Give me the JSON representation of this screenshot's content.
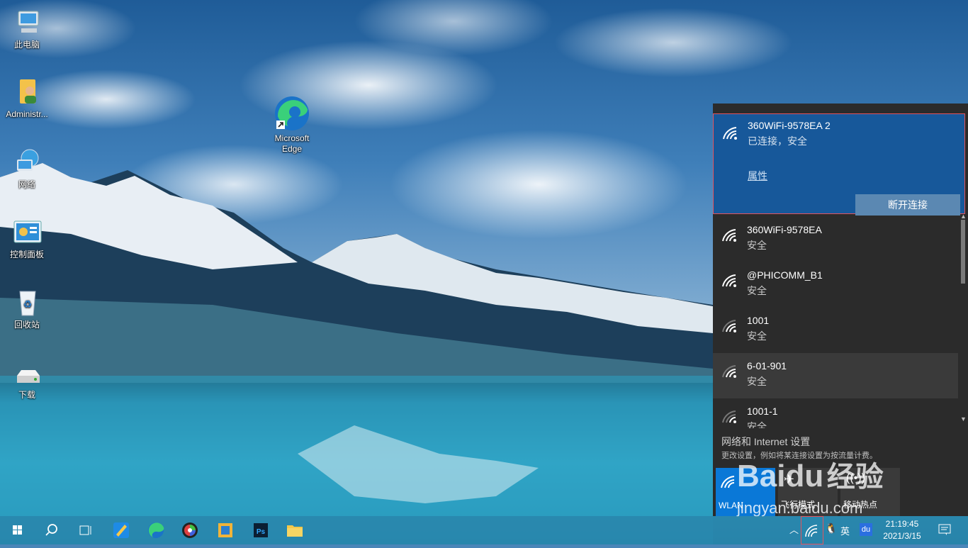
{
  "desktop": {
    "icons": [
      {
        "label": "此电脑"
      },
      {
        "label": "Administr..."
      },
      {
        "label": "网络"
      },
      {
        "label": "控制面板"
      },
      {
        "label": "回收站"
      },
      {
        "label": "下载"
      },
      {
        "label": "Microsoft\nEdge"
      }
    ]
  },
  "flyout": {
    "connected": {
      "ssid": "360WiFi-9578EA 2",
      "status": "已连接，安全",
      "properties_label": "属性",
      "disconnect_label": "断开连接"
    },
    "networks": [
      {
        "ssid": "360WiFi-9578EA",
        "status": "安全"
      },
      {
        "ssid": "@PHICOMM_B1",
        "status": "安全"
      },
      {
        "ssid": "1001",
        "status": "安全"
      },
      {
        "ssid": "6-01-901",
        "status": "安全"
      },
      {
        "ssid": "1001-1",
        "status": "安全"
      }
    ],
    "settings_link": "网络和 Internet 设置",
    "settings_desc": "更改设置，例如将某连接设置为按流量计费。",
    "quick_actions": [
      {
        "label": "WLAN",
        "icon": "wifi-icon",
        "active": true
      },
      {
        "label": "飞行模式",
        "icon": "airplane-icon",
        "active": false
      },
      {
        "label": "移动热点",
        "icon": "hotspot-icon",
        "active": false
      }
    ]
  },
  "taskbar": {
    "ime": "英",
    "baidu_label": "du",
    "time": "21:19:45",
    "date": "2021/3/15"
  },
  "watermark": {
    "brand": "Bai",
    "brand2": "du",
    "cn": "经验",
    "url": "jingyan.baidu.com"
  },
  "colors": {
    "connected_bg": "#17589a",
    "flyout_bg": "#2b2b2b",
    "accent": "#0a78d7",
    "highlight_border": "#e2545e"
  }
}
